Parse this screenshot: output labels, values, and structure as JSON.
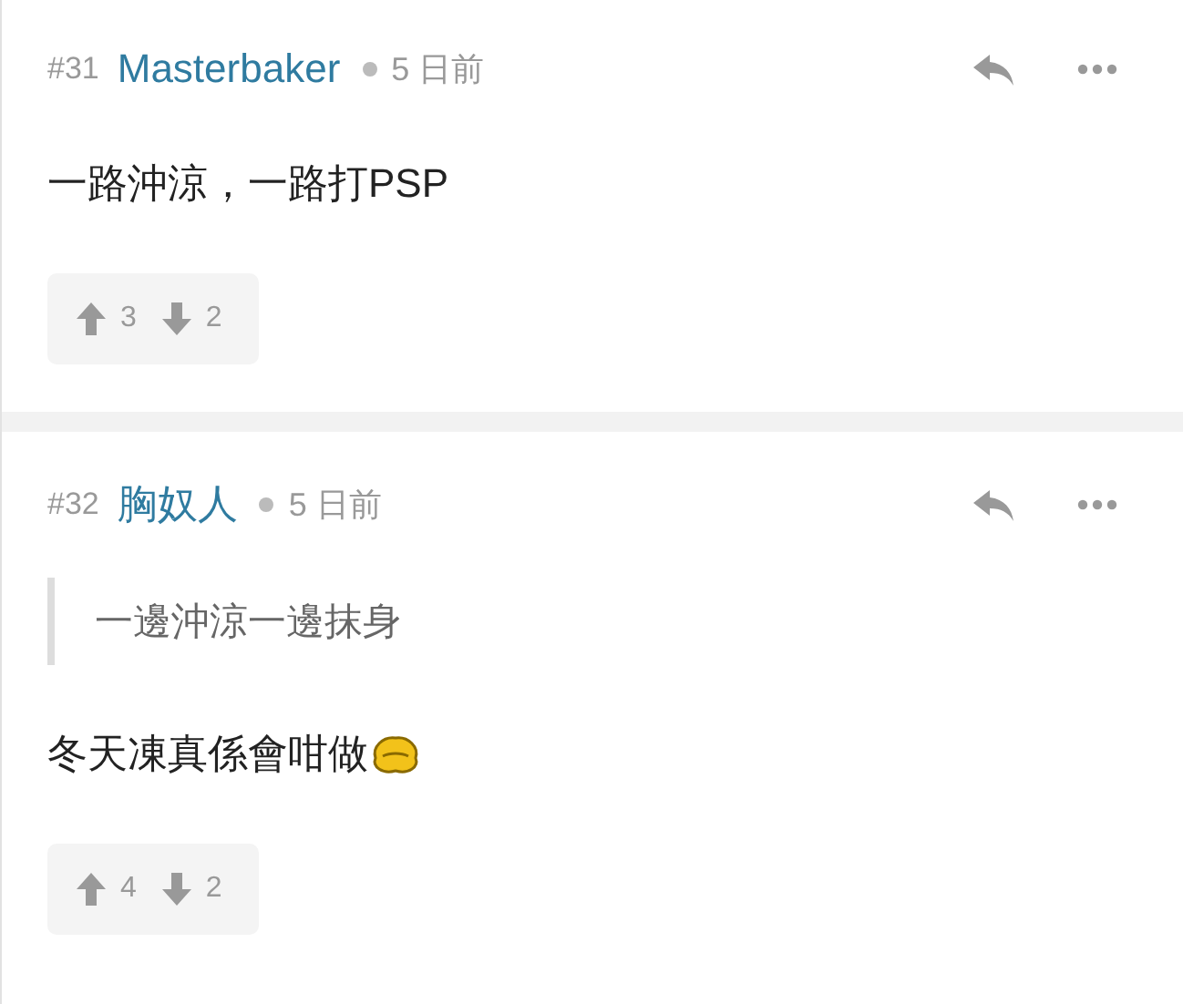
{
  "posts": [
    {
      "number": "#31",
      "author": "Masterbaker",
      "time": "5 日前",
      "blocks": [
        {
          "kind": "text",
          "text": "一路沖涼，一路打PSP",
          "sticker": false
        }
      ],
      "upvotes": "3",
      "downvotes": "2"
    },
    {
      "number": "#32",
      "author": "胸奴人",
      "time": "5 日前",
      "blocks": [
        {
          "kind": "quote",
          "text": "一邊沖涼一邊抹身"
        },
        {
          "kind": "text",
          "text": "冬天凍真係會咁做",
          "sticker": true
        }
      ],
      "upvotes": "4",
      "downvotes": "2"
    }
  ]
}
